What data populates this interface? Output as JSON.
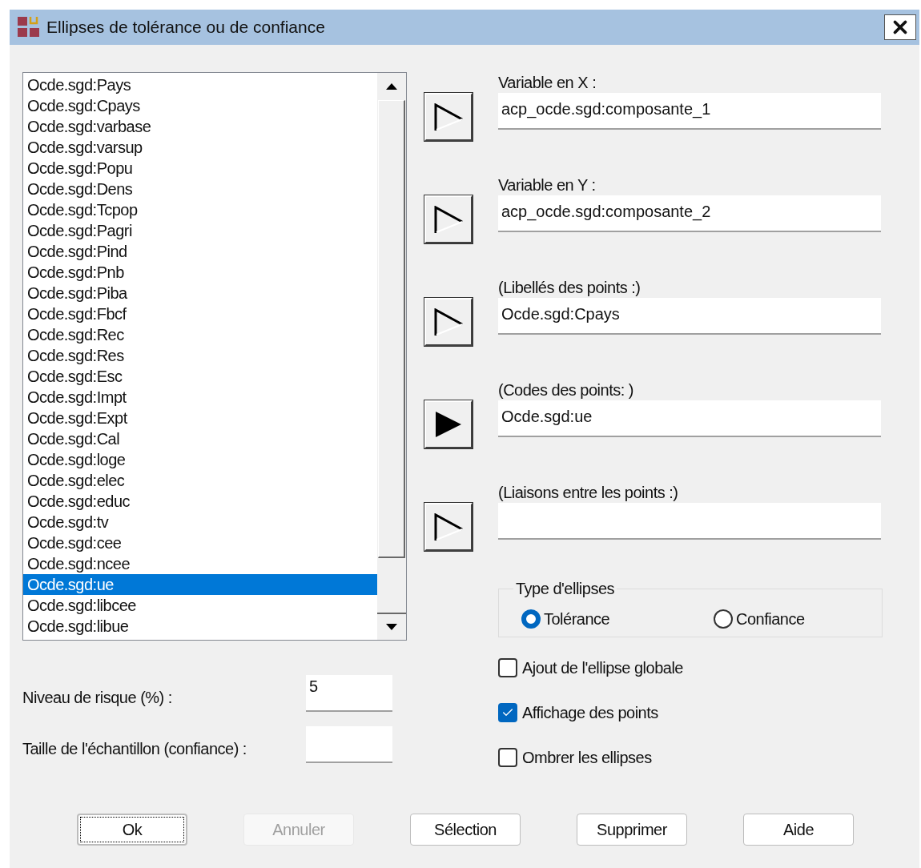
{
  "window": {
    "title": "Ellipses de tolérance ou de confiance"
  },
  "variables": {
    "items": [
      {
        "label": "Ocde.sgd:Pays",
        "selected": false
      },
      {
        "label": "Ocde.sgd:Cpays",
        "selected": false
      },
      {
        "label": "Ocde.sgd:varbase",
        "selected": false
      },
      {
        "label": "Ocde.sgd:varsup",
        "selected": false
      },
      {
        "label": "Ocde.sgd:Popu",
        "selected": false
      },
      {
        "label": "Ocde.sgd:Dens",
        "selected": false
      },
      {
        "label": "Ocde.sgd:Tcpop",
        "selected": false
      },
      {
        "label": "Ocde.sgd:Pagri",
        "selected": false
      },
      {
        "label": "Ocde.sgd:Pind",
        "selected": false
      },
      {
        "label": "Ocde.sgd:Pnb",
        "selected": false
      },
      {
        "label": "Ocde.sgd:Piba",
        "selected": false
      },
      {
        "label": "Ocde.sgd:Fbcf",
        "selected": false
      },
      {
        "label": "Ocde.sgd:Rec",
        "selected": false
      },
      {
        "label": "Ocde.sgd:Res",
        "selected": false
      },
      {
        "label": "Ocde.sgd:Esc",
        "selected": false
      },
      {
        "label": "Ocde.sgd:Impt",
        "selected": false
      },
      {
        "label": "Ocde.sgd:Expt",
        "selected": false
      },
      {
        "label": "Ocde.sgd:Cal",
        "selected": false
      },
      {
        "label": "Ocde.sgd:loge",
        "selected": false
      },
      {
        "label": "Ocde.sgd:elec",
        "selected": false
      },
      {
        "label": "Ocde.sgd:educ",
        "selected": false
      },
      {
        "label": "Ocde.sgd:tv",
        "selected": false
      },
      {
        "label": "Ocde.sgd:cee",
        "selected": false
      },
      {
        "label": "Ocde.sgd:ncee",
        "selected": false
      },
      {
        "label": "Ocde.sgd:ue",
        "selected": true
      },
      {
        "label": "Ocde.sgd:libcee",
        "selected": false
      },
      {
        "label": "Ocde.sgd:libue",
        "selected": false
      }
    ]
  },
  "slots": [
    {
      "label": "Variable en X :",
      "value": "acp_ocde.sgd:composante_1",
      "kind": "outline"
    },
    {
      "label": "Variable en Y :",
      "value": "acp_ocde.sgd:composante_2",
      "kind": "outline"
    },
    {
      "label": "(Libellés des points :)",
      "value": "Ocde.sgd:Cpays",
      "kind": "outline"
    },
    {
      "label": "(Codes des points: )",
      "value": "Ocde.sgd:ue",
      "kind": "filled"
    },
    {
      "label": "(Liaisons entre les points :)",
      "kind": "outline"
    }
  ],
  "ellipse_type": {
    "legend": "Type d'ellipses",
    "options": [
      {
        "label": "Tolérance",
        "selected": true
      },
      {
        "label": "Confiance",
        "selected": false
      }
    ]
  },
  "options": [
    {
      "label": "Ajout de l'ellipse globale",
      "checked": false
    },
    {
      "label": "Affichage des points",
      "checked": true
    },
    {
      "label": "Ombrer les ellipses",
      "checked": false
    }
  ],
  "params": [
    {
      "label": "Niveau de risque (%) :",
      "value": "5"
    },
    {
      "label": "Taille de l'échantillon (confiance) :"
    }
  ],
  "buttons": [
    {
      "label": "Ok",
      "focused": true,
      "disabled": false
    },
    {
      "label": "Annuler",
      "focused": false,
      "disabled": true
    },
    {
      "label": "Sélection",
      "focused": false,
      "disabled": false
    },
    {
      "label": "Supprimer",
      "focused": false,
      "disabled": false
    },
    {
      "label": "Aide",
      "focused": false,
      "disabled": false
    }
  ]
}
